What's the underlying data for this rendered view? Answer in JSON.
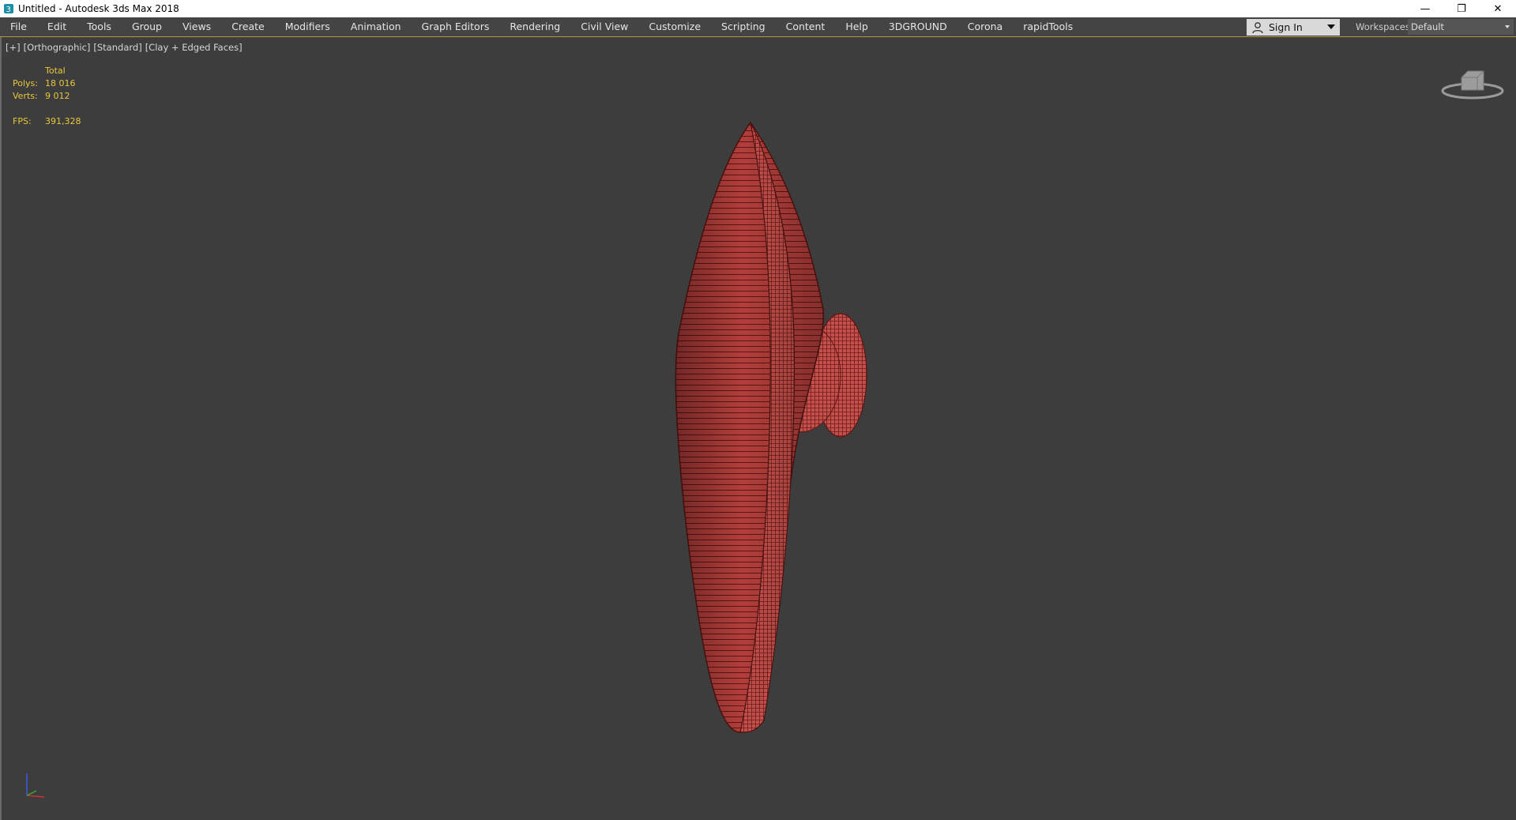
{
  "window": {
    "title": "Untitled - Autodesk 3ds Max 2018",
    "controls": {
      "minimize": "—",
      "restore": "❐",
      "close": "✕"
    }
  },
  "menubar": {
    "items": [
      "File",
      "Edit",
      "Tools",
      "Group",
      "Views",
      "Create",
      "Modifiers",
      "Animation",
      "Graph Editors",
      "Rendering",
      "Civil View",
      "Customize",
      "Scripting",
      "Content",
      "Help",
      "3DGROUND",
      "Corona",
      "rapidTools"
    ],
    "sign_in": "Sign In",
    "workspaces_label": "Workspaces:",
    "workspace_value": "Default"
  },
  "viewport": {
    "labels": [
      "[+]",
      "[Orthographic]",
      "[Standard]",
      "[Clay + Edged Faces]"
    ],
    "stats": {
      "header": "Total",
      "polys_label": "Polys:",
      "polys_value": "18 016",
      "verts_label": "Verts:",
      "verts_value": "9 012",
      "fps_label": "FPS:",
      "fps_value": "391,328"
    },
    "model_color": "#b03c3a",
    "stats_color": "#e8c83a"
  },
  "icons": [
    "app-icon",
    "user-icon",
    "viewcube-icon",
    "axis-tripod-icon"
  ]
}
